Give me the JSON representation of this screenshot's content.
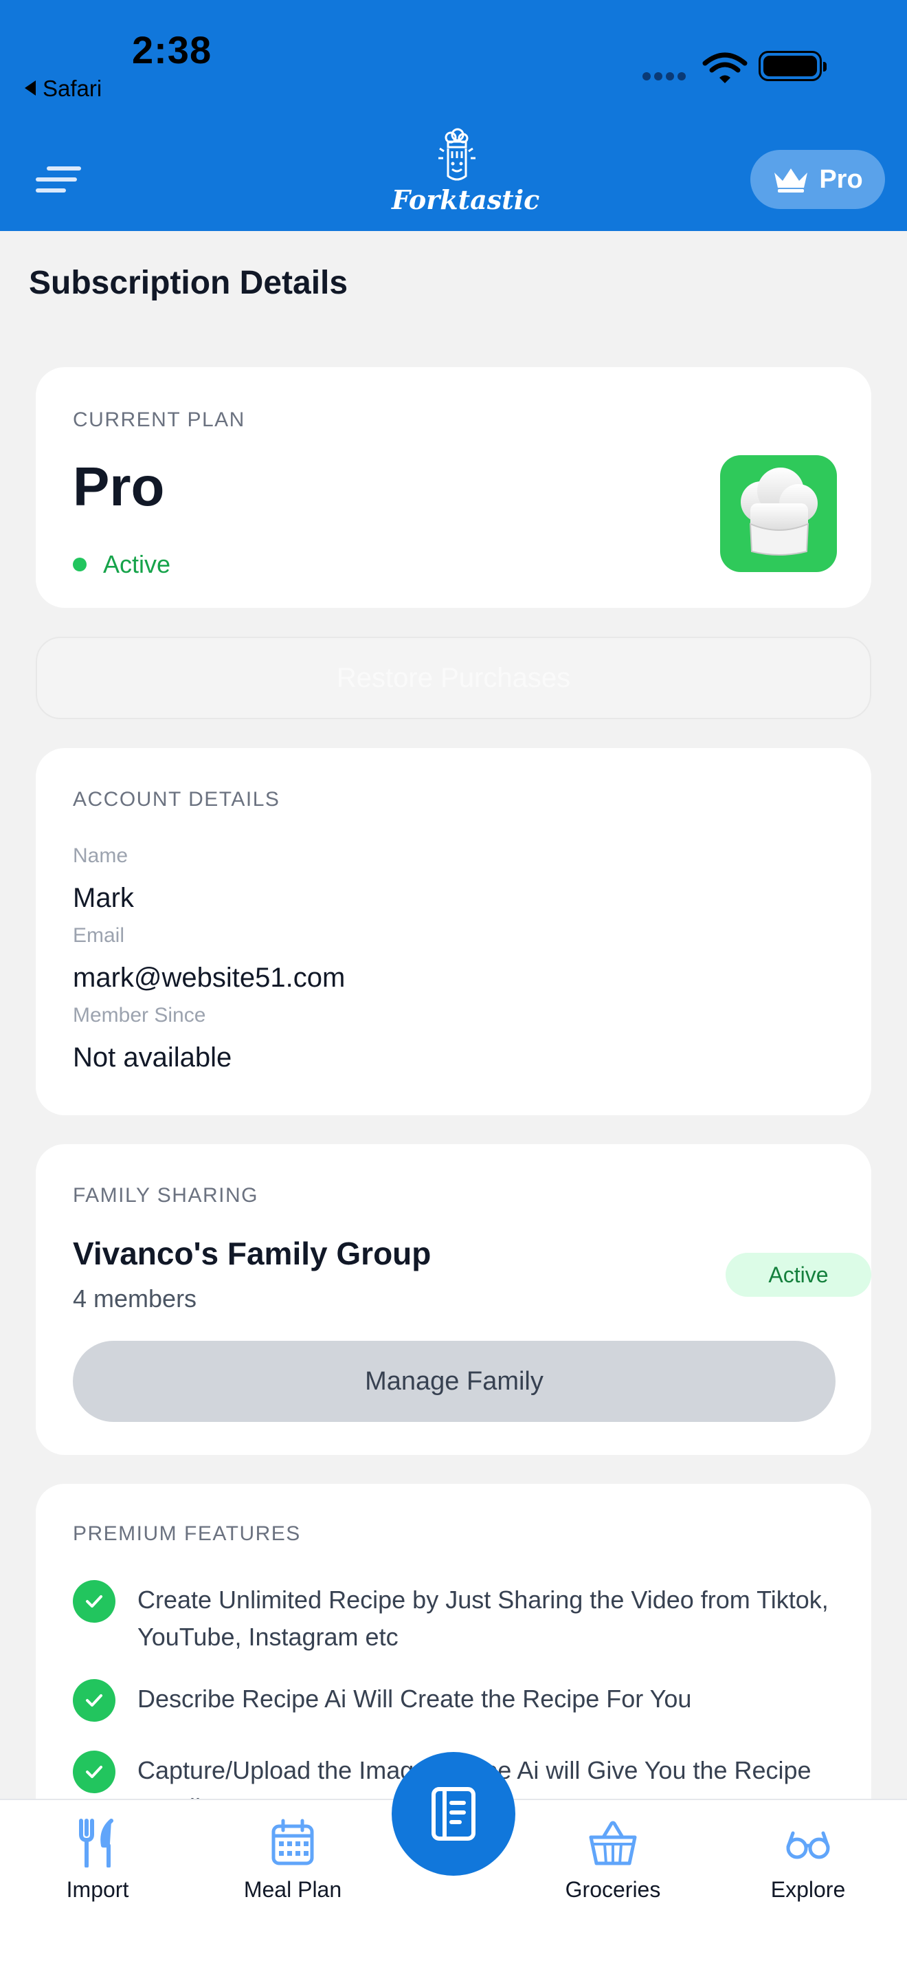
{
  "status_bar": {
    "time": "2:38",
    "back_app": "Safari"
  },
  "header": {
    "logo_text": "Forktastic",
    "pro_label": "Pro"
  },
  "page": {
    "title": "Subscription Details"
  },
  "plan": {
    "section_label": "CURRENT PLAN",
    "name": "Pro",
    "status": "Active",
    "icon": "chef-hat-icon"
  },
  "restore": {
    "label": "Restore Purchases"
  },
  "account": {
    "section_label": "ACCOUNT DETAILS",
    "name_label": "Name",
    "name_value": "Mark",
    "email_label": "Email",
    "email_value": "mark@website51.com",
    "member_label": "Member Since",
    "member_value": "Not available"
  },
  "family": {
    "section_label": "FAMILY SHARING",
    "group_name": "Vivanco's Family Group",
    "members": "4 members",
    "status": "Active",
    "manage_label": "Manage Family"
  },
  "features": {
    "section_label": "PREMIUM FEATURES",
    "items": [
      {
        "text": "Create Unlimited Recipe by Just Sharing the Video from Tiktok, YouTube, Instagram etc"
      },
      {
        "text": "Describe Recipe Ai Will Create the Recipe For You"
      },
      {
        "text": "Capture/Upload the Image Recipe Ai will Give You the Recipe Details"
      }
    ]
  },
  "nav": {
    "items": [
      {
        "label": "Import",
        "icon": "fork-knife-icon"
      },
      {
        "label": "Meal Plan",
        "icon": "calendar-icon"
      },
      {
        "label": "Groceries",
        "icon": "basket-icon"
      },
      {
        "label": "Explore",
        "icon": "glasses-icon"
      }
    ],
    "center_icon": "recipe-book-icon"
  },
  "colors": {
    "brand_blue": "#1177DB",
    "active_green": "#22c55e",
    "nav_icon_blue": "#3b82f6"
  }
}
